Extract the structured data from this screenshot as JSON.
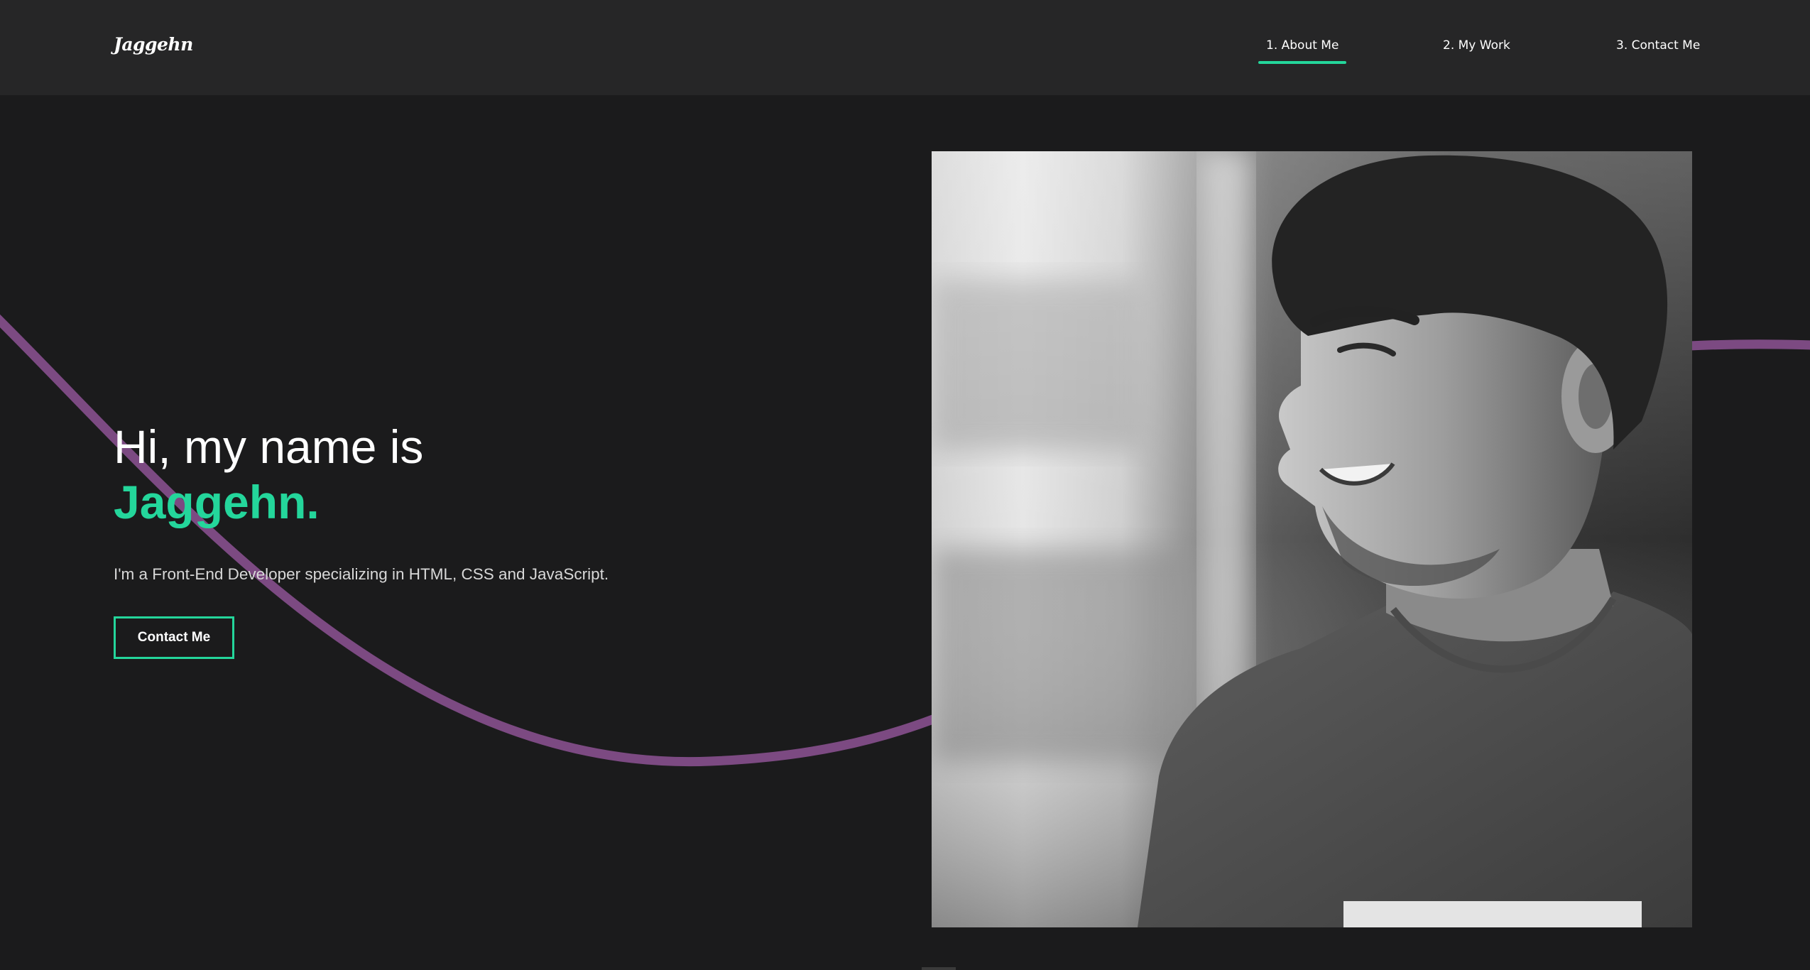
{
  "header": {
    "logo": "Jaggehn",
    "nav": [
      {
        "label": "1. About Me",
        "active": true
      },
      {
        "label": "2. My Work",
        "active": false
      },
      {
        "label": "3. Contact Me",
        "active": false
      }
    ]
  },
  "hero": {
    "greeting": "Hi, my name is",
    "name": "Jaggehn.",
    "tagline": "I'm a Front-End Developer specializing in HTML, CSS and JavaScript.",
    "cta_label": "Contact Me"
  },
  "colors": {
    "background": "#1b1b1c",
    "header_background": "#262627",
    "accent": "#24d69b",
    "curve": "#7c4a82"
  },
  "portrait": {
    "icon": "person-portrait-photo",
    "style": "black-and-white"
  }
}
